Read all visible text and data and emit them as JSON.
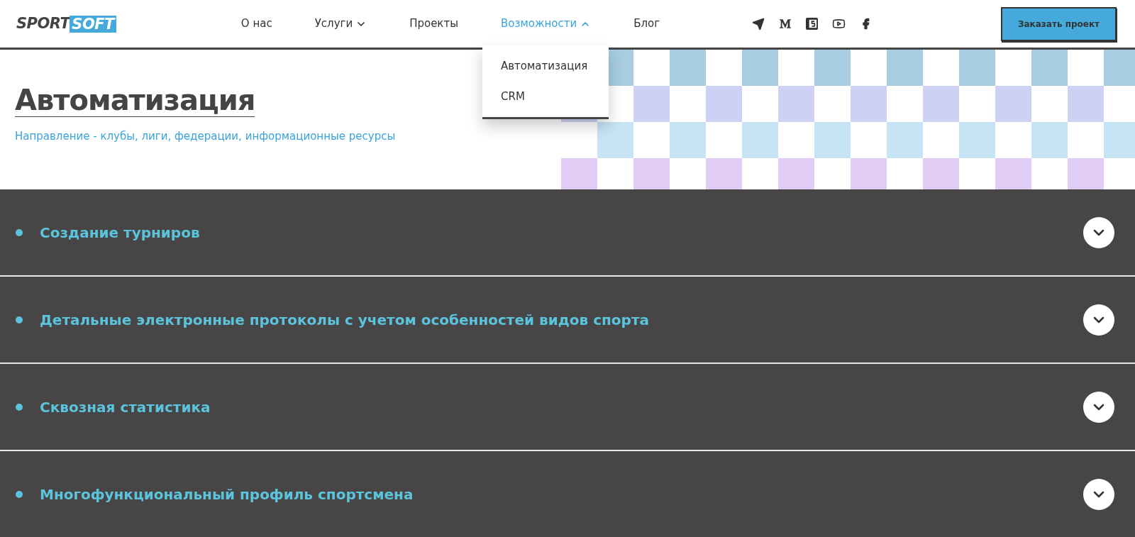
{
  "logo": {
    "part_1": "SPORT",
    "part_2": "SOFT"
  },
  "nav": [
    {
      "label": "О нас",
      "kind": "link",
      "selected": false
    },
    {
      "label": "Услуги",
      "kind": "dropdown",
      "expanded": false,
      "selected": false
    },
    {
      "label": "Проекты",
      "kind": "link",
      "selected": false
    },
    {
      "label": "Возможности",
      "kind": "dropdown",
      "expanded": true,
      "selected": true,
      "menu": [
        "Автоматизация",
        "CRM"
      ]
    },
    {
      "label": "Блог",
      "kind": "link",
      "selected": false
    }
  ],
  "social": [
    {
      "kind": "telegram"
    },
    {
      "kind": "medium"
    },
    {
      "kind": "tenchat"
    },
    {
      "kind": "youtube"
    },
    {
      "kind": "facebook"
    }
  ],
  "cta": "Заказать проект",
  "hero": {
    "title": "Автоматизация",
    "subtitle": "Направление - клубы, лиги, федерации, информационные ресурсы"
  },
  "features": [
    {
      "title": "Создание турниров",
      "expanded": false
    },
    {
      "title": "Детальные электронные протоколы с учетом особенностей видов спорта",
      "expanded": false
    },
    {
      "title": "Сквозная статистика",
      "expanded": false
    },
    {
      "title": "Многофункциональный профиль спортсмена",
      "expanded": false
    }
  ]
}
